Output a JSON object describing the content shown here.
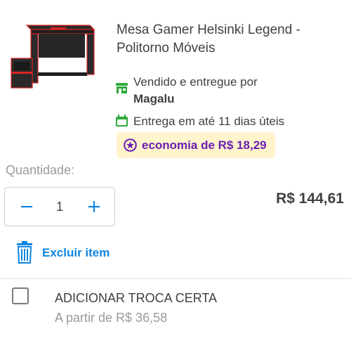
{
  "product": {
    "title": "Mesa Gamer Helsinki Legend - Politorno Móveis",
    "image_alt": "Mesa Gamer Helsinki Legend"
  },
  "seller": {
    "line": "Vendido e entregue por",
    "name": "Magalu"
  },
  "delivery": {
    "text": "Entrega em até 11 dias úteis"
  },
  "savings": {
    "text": "economia de R$ 18,29"
  },
  "quantity": {
    "label": "Quantidade:",
    "value": "1",
    "minus_symbol": "−",
    "plus_symbol": "+"
  },
  "price": {
    "value": "R$ 144,61"
  },
  "actions": {
    "remove_label": "Excluir item"
  },
  "addon": {
    "title": "ADICIONAR TROCA CERTA",
    "price": "A partir de R$ 36,58",
    "checked": false
  },
  "icons": {
    "seller": "store-icon",
    "delivery": "calendar-icon",
    "savings": "star-badge-icon",
    "remove": "trash-icon"
  },
  "colors": {
    "green": "#2faa3e",
    "purple": "#6a1fb3",
    "savings_bg": "#fff4cc",
    "blue": "#0f86e0",
    "text": "#404040",
    "muted": "#9a9a9a"
  }
}
